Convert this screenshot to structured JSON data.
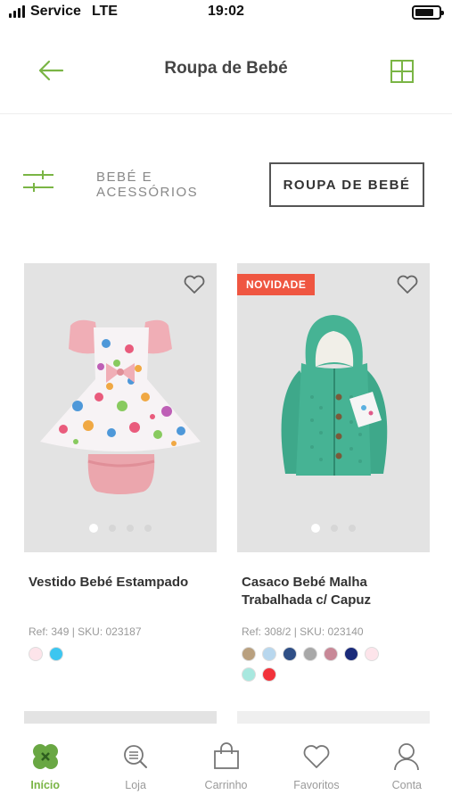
{
  "status_bar": {
    "carrier": "Service",
    "network": "LTE",
    "time": "19:02",
    "battery_level": 0.75
  },
  "header": {
    "title": "Roupa de Bebé",
    "back_icon": "arrow-left-icon",
    "layout_icon": "grid-view-icon"
  },
  "filters": {
    "filter_icon": "sliders-icon",
    "tabs": [
      {
        "label": "BEBÉ E ACESSÓRIOS",
        "active": false
      },
      {
        "label": "ROUPA DE BEBÉ",
        "active": true
      }
    ]
  },
  "products": [
    {
      "name": "Vestido Bebé Estampado",
      "ref": "Ref: 349 | SKU: 023187",
      "badge": "",
      "image_dots": 4,
      "active_dot": 0,
      "swatches": [
        "#fde4ea",
        "#3cc6f0"
      ]
    },
    {
      "name": "Casaco Bebé Malha Trabalhada c/ Capuz",
      "ref": "Ref: 308/2 | SKU: 023140",
      "badge": "NOVIDADE",
      "image_dots": 3,
      "active_dot": 0,
      "swatches": [
        "#b9a07f",
        "#b8d7ee",
        "#2f4f86",
        "#a8a8a8",
        "#c88897",
        "#1a2a7a",
        "#fde4ea",
        "#a8e8df",
        "#f2323a"
      ]
    }
  ],
  "bottom_nav": [
    {
      "label": "Início",
      "icon": "clover-icon",
      "active": true
    },
    {
      "label": "Loja",
      "icon": "search-list-icon",
      "active": false
    },
    {
      "label": "Carrinho",
      "icon": "shopping-bag-icon",
      "active": false
    },
    {
      "label": "Favoritos",
      "icon": "heart-icon",
      "active": false
    },
    {
      "label": "Conta",
      "icon": "user-icon",
      "active": false
    }
  ],
  "colors": {
    "accent": "#7ab545",
    "badge": "#ef5641",
    "clover": "#69a743"
  }
}
